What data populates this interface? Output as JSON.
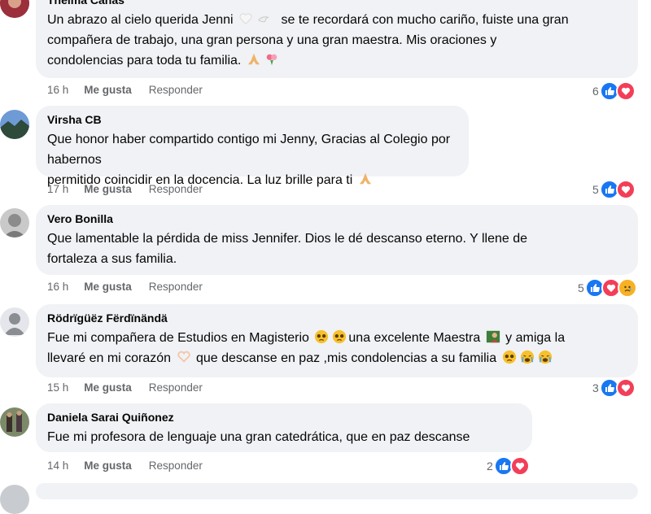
{
  "comments": [
    {
      "author": "Thelma Cañas",
      "text_a": "Un abrazo al cielo querida Jenni",
      "text_b": "se te recordará con mucho cariño, fuiste una gran",
      "text_c": "compañera de trabajo, una gran persona y una gran maestra. Mis oraciones y",
      "text_d": "condolencias para toda tu familia.",
      "time": "16 h",
      "like": "Me gusta",
      "reply": "Responder",
      "reaction_count": "6",
      "reactions": [
        "like",
        "love"
      ],
      "emojis": [
        "white-heart",
        "dove",
        "praying-hands",
        "bouquet"
      ]
    },
    {
      "author": "Virsha CB",
      "text_a": "Que honor haber compartido contigo mi Jenny, Gracias al Colegio por habernos",
      "text_b": "permitido coincidir en la docencia. La luz brille para ti",
      "time": "17 h",
      "like": "Me gusta",
      "reply": "Responder",
      "reaction_count": "5",
      "reactions": [
        "like",
        "love"
      ],
      "emojis": [
        "praying-hands"
      ]
    },
    {
      "author": "Vero Bonilla",
      "text_a": "Que lamentable la pérdida de miss Jennifer. Dios le dé descanso eterno. Y llene de",
      "text_b": "fortaleza a sus familia.",
      "time": "16 h",
      "like": "Me gusta",
      "reply": "Responder",
      "reaction_count": "5",
      "reactions": [
        "like",
        "love",
        "sad"
      ]
    },
    {
      "author": "Rödrïgüëz Fërdïnändä",
      "text_a": "Fue mi compañera de Estudios en Magisterio",
      "text_b": "una excelente Maestra",
      "text_c": "y amiga la",
      "text_d": "llevaré en mi corazón",
      "text_e": "que descanse en paz ,mis condolencias a su familia",
      "time": "15 h",
      "like": "Me gusta",
      "reply": "Responder",
      "reaction_count": "3",
      "reactions": [
        "like",
        "love"
      ],
      "emojis": [
        "pleading-face",
        "pleading-face",
        "teacher",
        "heart-hands",
        "pleading-face",
        "crying-face",
        "crying-face"
      ]
    },
    {
      "author": "Daniela Sarai Quiñonez",
      "text_a": "Fue mi profesora de lenguaje una gran catedrática, que en paz descanse",
      "time": "14 h",
      "like": "Me gusta",
      "reply": "Responder",
      "reaction_count": "2",
      "reactions": [
        "like",
        "love"
      ]
    }
  ],
  "colors": {
    "bubble": "#f0f2f5",
    "meta_text": "#65676b",
    "like_blue": "#1877f2",
    "love_red": "#f33e58",
    "sad_yellow": "#f7b125"
  }
}
